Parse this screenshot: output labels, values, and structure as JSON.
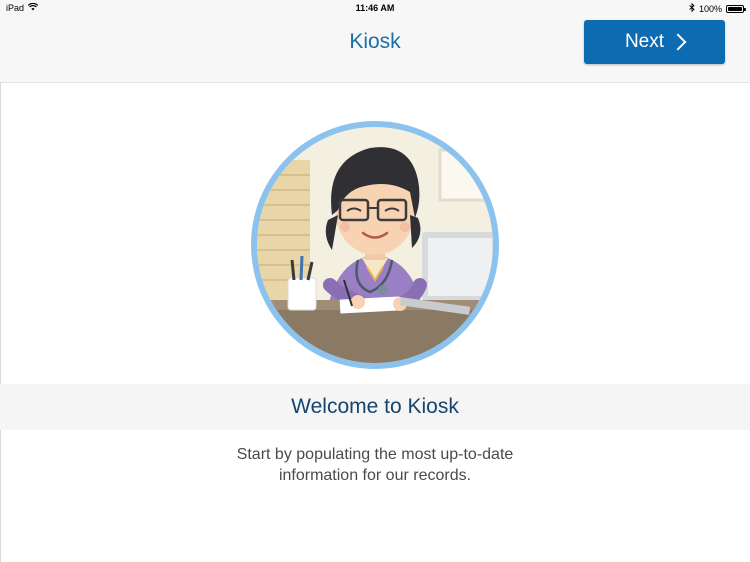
{
  "status_bar": {
    "device": "iPad",
    "time": "11:46 AM",
    "battery": "100%"
  },
  "nav": {
    "title": "Kiosk",
    "next_label": "Next"
  },
  "welcome": {
    "title": "Welcome to Kiosk",
    "line1": "Start by populating the most up-to-date",
    "line2": "information for our records."
  },
  "colors": {
    "accent": "#0d6bb1",
    "title": "#1b6fa8",
    "welcome": "#15456e",
    "avatar_ring": "#8cc3ee"
  },
  "icons": [
    "wifi-icon",
    "bluetooth-icon",
    "battery-icon",
    "chevron-right-icon",
    "doctor-illustration"
  ]
}
